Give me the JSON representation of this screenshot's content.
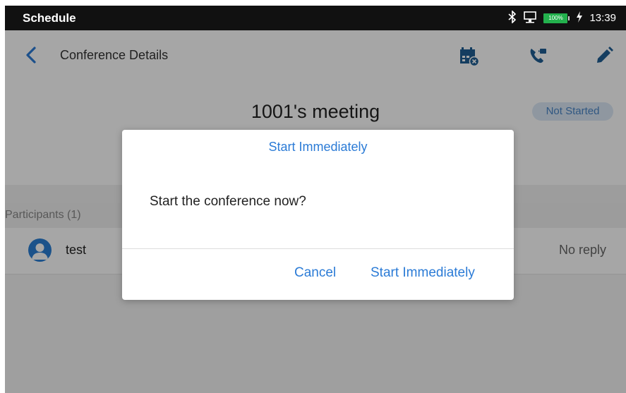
{
  "status_bar": {
    "title": "Schedule",
    "time": "13:39",
    "battery_label": "100%",
    "battery_color": "#23b14d",
    "icons": [
      "bluetooth-icon",
      "network-icon",
      "battery-icon",
      "charging-icon"
    ]
  },
  "app_bar": {
    "title": "Conference Details",
    "icons": [
      "back-icon",
      "calendar-cancel-icon",
      "call-icon",
      "edit-icon"
    ],
    "accent_color": "#2b7bd6"
  },
  "meeting": {
    "title": "1001's meeting",
    "status": "Not Started"
  },
  "participants": {
    "label": "Participants (1)",
    "items": [
      {
        "name": "test",
        "status": "No reply"
      }
    ]
  },
  "dialog": {
    "title": "Start Immediately",
    "message": "Start the conference now?",
    "cancel_label": "Cancel",
    "confirm_label": "Start Immediately"
  }
}
